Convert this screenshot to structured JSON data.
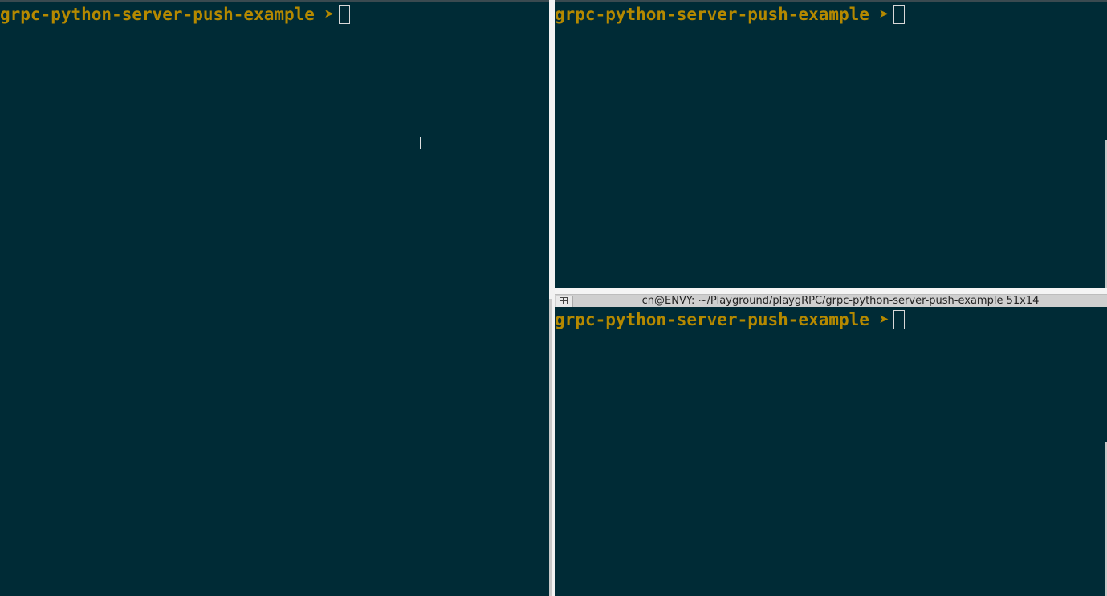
{
  "panes": {
    "left": {
      "prompt_dir": "grpc-python-server-push-example",
      "prompt_symbol": "➤"
    },
    "top_right": {
      "prompt_dir": "grpc-python-server-push-example",
      "prompt_symbol": "➤"
    },
    "bottom_right": {
      "prompt_dir": "grpc-python-server-push-example",
      "prompt_symbol": "➤",
      "title": "cn@ENVY: ~/Playground/playgRPC/grpc-python-server-push-example 51x14"
    }
  },
  "colors": {
    "terminal_bg": "#002b36",
    "prompt_fg": "#b58900",
    "divider": "#f2f2f2"
  },
  "icons": {
    "pane_icon": "terminal-split-icon",
    "mouse_cursor": "text-ibeam-icon"
  }
}
